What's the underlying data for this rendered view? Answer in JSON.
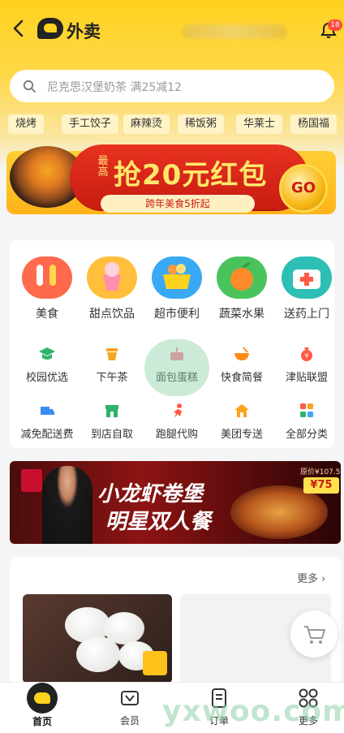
{
  "header": {
    "back_icon": "chevron-left-icon",
    "title": "外卖",
    "bell_badge": "18"
  },
  "search": {
    "placeholder": "尼克思汉堡奶茶 满25减12"
  },
  "quick_tags": [
    "烧烤",
    "手工饺子",
    "麻辣烫",
    "稀饭粥",
    "华莱士",
    "杨国福"
  ],
  "promo_banner": {
    "small_text": "最高",
    "headline": "抢20元红包",
    "subline": "跨年美食5折起",
    "button": "GO"
  },
  "categories_primary": [
    {
      "label": "美食",
      "icon": "food-icon",
      "color": "#ff6a4d"
    },
    {
      "label": "甜点饮品",
      "icon": "dessert-icon",
      "color": "#ffbf3a"
    },
    {
      "label": "超市便利",
      "icon": "basket-icon",
      "color": "#3aa9f5"
    },
    {
      "label": "蔬菜水果",
      "icon": "fruit-icon",
      "color": "#4ac35d"
    },
    {
      "label": "送药上门",
      "icon": "medicine-icon",
      "color": "#2dbfb5"
    }
  ],
  "categories_secondary": [
    {
      "label": "校园优选",
      "icon": "graduation-cap-icon",
      "color": "#2fb36c"
    },
    {
      "label": "下午茶",
      "icon": "tea-cup-icon",
      "color": "#f5a623"
    },
    {
      "label": "面包蛋糕",
      "icon": "cake-icon",
      "color": "#ff7f9a"
    },
    {
      "label": "快食简餐",
      "icon": "bowl-icon",
      "color": "#ff8c1a"
    },
    {
      "label": "津贴联盟",
      "icon": "money-bag-icon",
      "color": "#ff5a45"
    },
    {
      "label": "减免配送费",
      "icon": "delivery-truck-icon",
      "color": "#3a8cf5"
    },
    {
      "label": "到店自取",
      "icon": "store-icon",
      "color": "#2fb36c"
    },
    {
      "label": "跑腿代购",
      "icon": "runner-icon",
      "color": "#ff5a45"
    },
    {
      "label": "美团专送",
      "icon": "house-rider-icon",
      "color": "#ffa31a"
    },
    {
      "label": "全部分类",
      "icon": "grid-icon",
      "color": "#3aa9f5"
    }
  ],
  "ad_banner": {
    "line1": "小龙虾卷堡",
    "line2": "明星双人餐",
    "price_tag": "原价¥107.5",
    "price": "¥75"
  },
  "recommend": {
    "more_label": "更多"
  },
  "tabbar": [
    {
      "label": "首页",
      "icon": "home-logo-icon",
      "active": true
    },
    {
      "label": "会员",
      "icon": "vip-icon",
      "active": false
    },
    {
      "label": "订单",
      "icon": "order-icon",
      "active": false
    },
    {
      "label": "更多",
      "icon": "more-grid-icon",
      "active": false
    }
  ],
  "watermark": "yxwoo.com",
  "colors": {
    "brand_yellow": "#ffd21e",
    "banner_red": "#c81c12",
    "badge_red": "#ff4a3d"
  }
}
